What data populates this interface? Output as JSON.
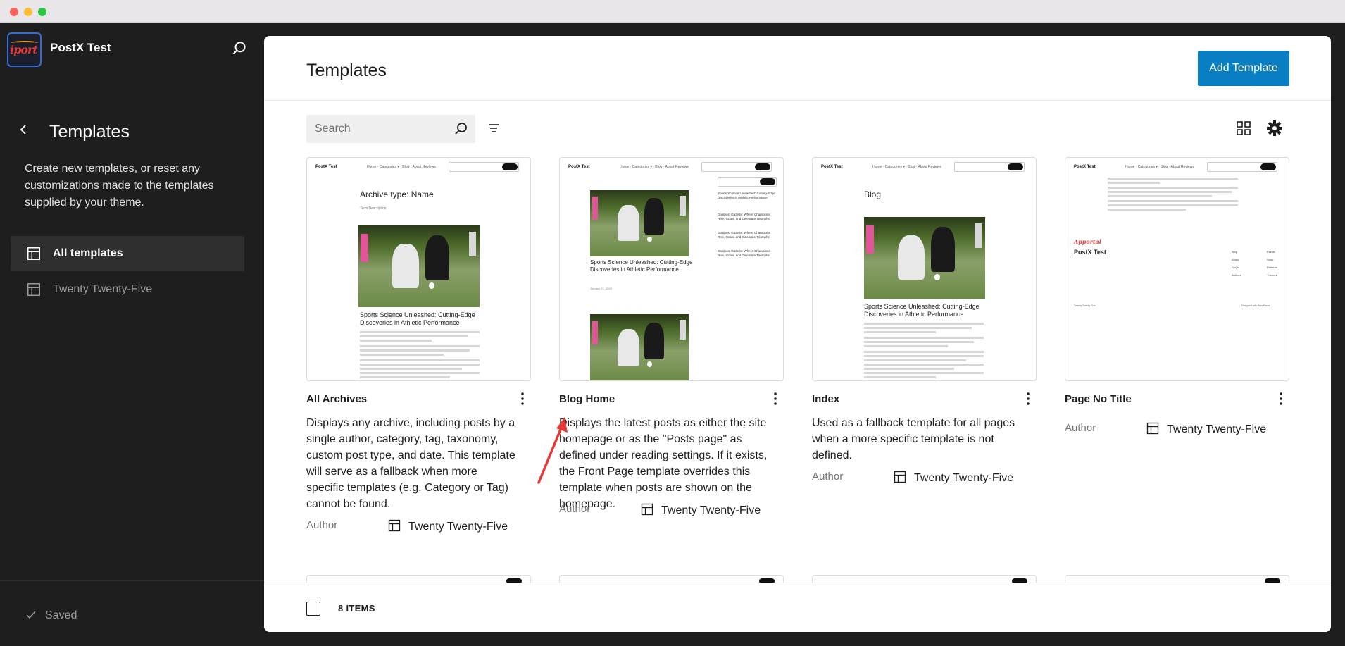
{
  "site": {
    "name": "PostX Test",
    "logo_text": "iport"
  },
  "sidebar": {
    "title": "Templates",
    "description": "Create new templates, or reset any customizations made to the templates supplied by your theme.",
    "items": [
      {
        "label": "All templates",
        "icon": "layout-icon",
        "active": true
      },
      {
        "label": "Twenty Twenty-Five",
        "icon": "layout-icon",
        "active": false
      }
    ],
    "footer_status": "Saved"
  },
  "main": {
    "title": "Templates",
    "add_button": "Add Template",
    "search_placeholder": "Search",
    "item_count": "8 ITEMS",
    "cards": [
      {
        "title": "All Archives",
        "description": "Displays any archive, including posts by a single author, category, tag, taxonomy, custom post type, and date. This template will serve as a fallback when more specific templates (e.g. Category or Tag) cannot be found.",
        "author_label": "Author",
        "theme": "Twenty Twenty-Five",
        "thumb_heading": "Archive type: Name",
        "thumb_subheading": "Term Description",
        "thumb_post_title": "Sports Science Unleashed: Cutting-Edge Discoveries in Athletic Performance"
      },
      {
        "title": "Blog Home",
        "description": "Displays the latest posts as either the site homepage or as the \"Posts page\" as defined under reading settings. If it exists, the Front Page template overrides this template when posts are shown on the homepage.",
        "author_label": "Author",
        "theme": "Twenty Twenty-Five",
        "thumb_post_title": "Sports Science Unleashed: Cutting-Edge Discoveries in Athletic Performance",
        "thumb_date": "January 21, 2025",
        "thumb_sidebar_items": [
          "Sports Science Unleashed: Cutting-Edge Discoveries in Athletic Performance",
          "Goalpost Gazette: Where Champions Rise, Goals, and Celebrate Triumphs",
          "Goalpost Gazette: Where Champions Rise, Goals, and Celebrate Triumphs",
          "Goalpost Gazette: Where Champions Rise, Goals, and Celebrate Triumphs"
        ]
      },
      {
        "title": "Index",
        "description": "Used as a fallback template for all pages when a more specific template is not defined.",
        "author_label": "Author",
        "theme": "Twenty Twenty-Five",
        "thumb_heading": "Blog",
        "thumb_post_title": "Sports Science Unleashed: Cutting-Edge Discoveries in Athletic Performance"
      },
      {
        "title": "Page No Title",
        "author_label": "Author",
        "theme": "Twenty Twenty-Five",
        "thumb_brand": "PostX Test",
        "thumb_logo": "Apportal",
        "thumb_footer_left": "Twenty Twenty-Five",
        "thumb_footer_right": "Designed with WordPress",
        "thumb_links_a": [
          "Blog",
          "About",
          "FAQs",
          "Authors"
        ],
        "thumb_links_b": [
          "Events",
          "Shop",
          "Patterns",
          "Themes"
        ]
      }
    ]
  },
  "colors": {
    "accent": "#0a7ec2",
    "sidebar_bg": "#1e1e1e",
    "arrow": "#e53935"
  }
}
